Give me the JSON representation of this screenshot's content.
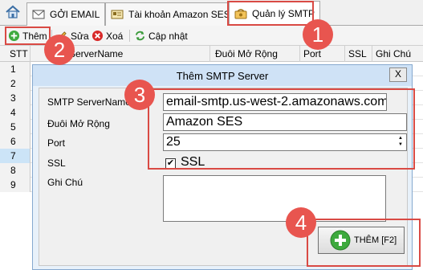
{
  "tabs": [
    {
      "label": "GỞI EMAIL",
      "icon": "envelope-icon"
    },
    {
      "label": "Tài khoản Amazon SES",
      "icon": "account-card-icon"
    },
    {
      "label": "Quản lý SMTP",
      "icon": "smtp-manage-icon",
      "active": true
    }
  ],
  "toolbar": {
    "add_label": "Thêm",
    "edit_label": "Sửa",
    "delete_label": "Xoá",
    "refresh_label": "Cập nhật"
  },
  "grid": {
    "columns": [
      "STT",
      "ServerName",
      "Đuôi Mở Rộng",
      "Port",
      "SSL",
      "Ghi Chú"
    ],
    "rows": [
      "1",
      "2",
      "3",
      "4",
      "5",
      "6",
      "7",
      "8",
      "9"
    ],
    "selected_row": "7"
  },
  "dialog": {
    "title": "Thêm SMTP Server",
    "close_label": "X",
    "fields": {
      "server_label": "SMTP ServerName",
      "server_value": "email-smtp.us-west-2.amazonaws.com",
      "suffix_label": "Đuôi Mở Rộng",
      "suffix_value": "Amazon SES",
      "port_label": "Port",
      "port_value": "25",
      "ssl_label": "SSL",
      "ssl_checkbox_label": "SSL",
      "ssl_checked": true,
      "note_label": "Ghi Chú",
      "note_value": ""
    },
    "add_button_label": "THÊM [F2]"
  },
  "annotations": [
    "1",
    "2",
    "3",
    "4"
  ],
  "colors": {
    "annotation_red": "#e8554f",
    "add_green": "#3daa3d",
    "delete_red": "#d82a2a",
    "selected_row": "#cce4f7"
  }
}
